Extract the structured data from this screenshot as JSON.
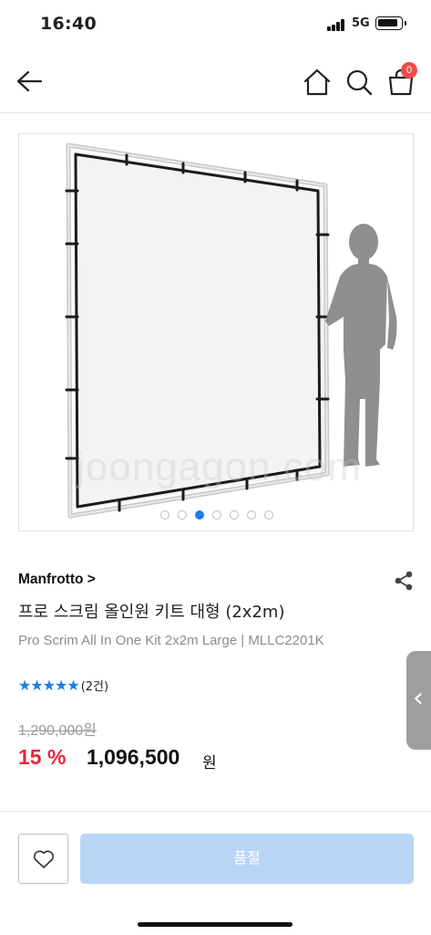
{
  "status_bar": {
    "time": "16:40",
    "network": "5G"
  },
  "header": {
    "cart_count": "0"
  },
  "gallery": {
    "watermark": "joongagon.com",
    "dot_count": 7,
    "active_index": 2
  },
  "product": {
    "brand": "Manfrotto >",
    "title_ko": "프로 스크림 올인원 키트 대형 (2x2m)",
    "title_en": "Pro Scrim All In One Kit 2x2m Large | MLLC2201K",
    "stars": "★★★★★",
    "rating_value": 5,
    "review_count": "(2건)",
    "original_price": "1,290,000원",
    "discount": "15 %",
    "sale_price": "1,096,500",
    "currency": "원"
  },
  "side_tab": {
    "label": "‹"
  },
  "bottom_bar": {
    "soldout_label": "품절"
  },
  "colors": {
    "accent": "#1c7ee6",
    "discount": "#e5283c",
    "soldout_button": "#b8d5f6",
    "badge": "#f04b4b"
  }
}
